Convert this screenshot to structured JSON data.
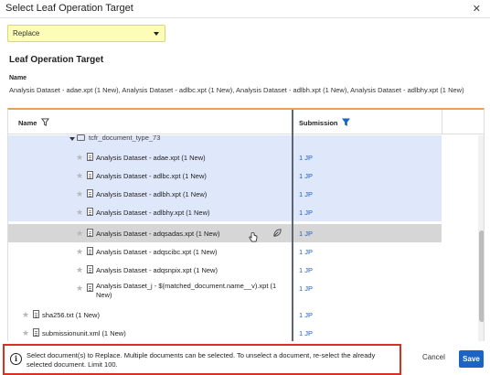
{
  "dialog": {
    "title": "Select Leaf Operation Target",
    "close_glyph": "✕"
  },
  "operation_select": {
    "value": "Replace"
  },
  "section_title": "Leaf Operation Target",
  "name_label": "Name",
  "name_value": "Analysis Dataset - adae.xpt (1 New), Analysis Dataset - adlbc.xpt (1 New), Analysis Dataset - adlbh.xpt (1 New), Analysis Dataset - adlbhy.xpt (1 New)",
  "grid": {
    "col_name": "Name",
    "col_submission": "Submission",
    "folder_label": "tcfr_document_type_73",
    "rows": [
      {
        "label": "Analysis Dataset - adae.xpt (1 New)",
        "submission": "1 JP",
        "state": "selected"
      },
      {
        "label": "Analysis Dataset - adlbc.xpt (1 New)",
        "submission": "1 JP",
        "state": "selected"
      },
      {
        "label": "Analysis Dataset - adlbh.xpt (1 New)",
        "submission": "1 JP",
        "state": "selected"
      },
      {
        "label": "Analysis Dataset - adlbhy.xpt (1 New)",
        "submission": "1 JP",
        "state": "selected"
      },
      {
        "label": "Analysis Dataset - adqsadas.xpt (1 New)",
        "submission": "1 JP",
        "state": "hover"
      },
      {
        "label": "Analysis Dataset - adqscibc.xpt (1 New)",
        "submission": "1 JP",
        "state": "normal"
      },
      {
        "label": "Analysis Dataset - adqsnpix.xpt (1 New)",
        "submission": "1 JP",
        "state": "normal"
      },
      {
        "label": "Analysis Dataset_j - $(matched_document.name__v).xpt (1 New)",
        "submission": "1 JP",
        "state": "normal"
      },
      {
        "label": "sha256.txt (1 New)",
        "submission": "1 JP",
        "state": "normal"
      },
      {
        "label": "submissionunit.xml (1 New)",
        "submission": "1 JP",
        "state": "normal"
      }
    ]
  },
  "footer": {
    "info_text": "Select document(s) to Replace. Multiple documents can be selected. To unselect a document, re-select the already selected document. Limit 100.",
    "cancel_label": "Cancel",
    "save_label": "Save"
  },
  "colors": {
    "dropdown_bg": "#fdfdb8",
    "selected_row": "#dfe8fb",
    "hover_row": "#d6d6d6",
    "link_blue": "#1f5fbf",
    "save_blue": "#1b64c6",
    "grid_top_border": "#e8a05a",
    "info_border": "#d93025"
  }
}
